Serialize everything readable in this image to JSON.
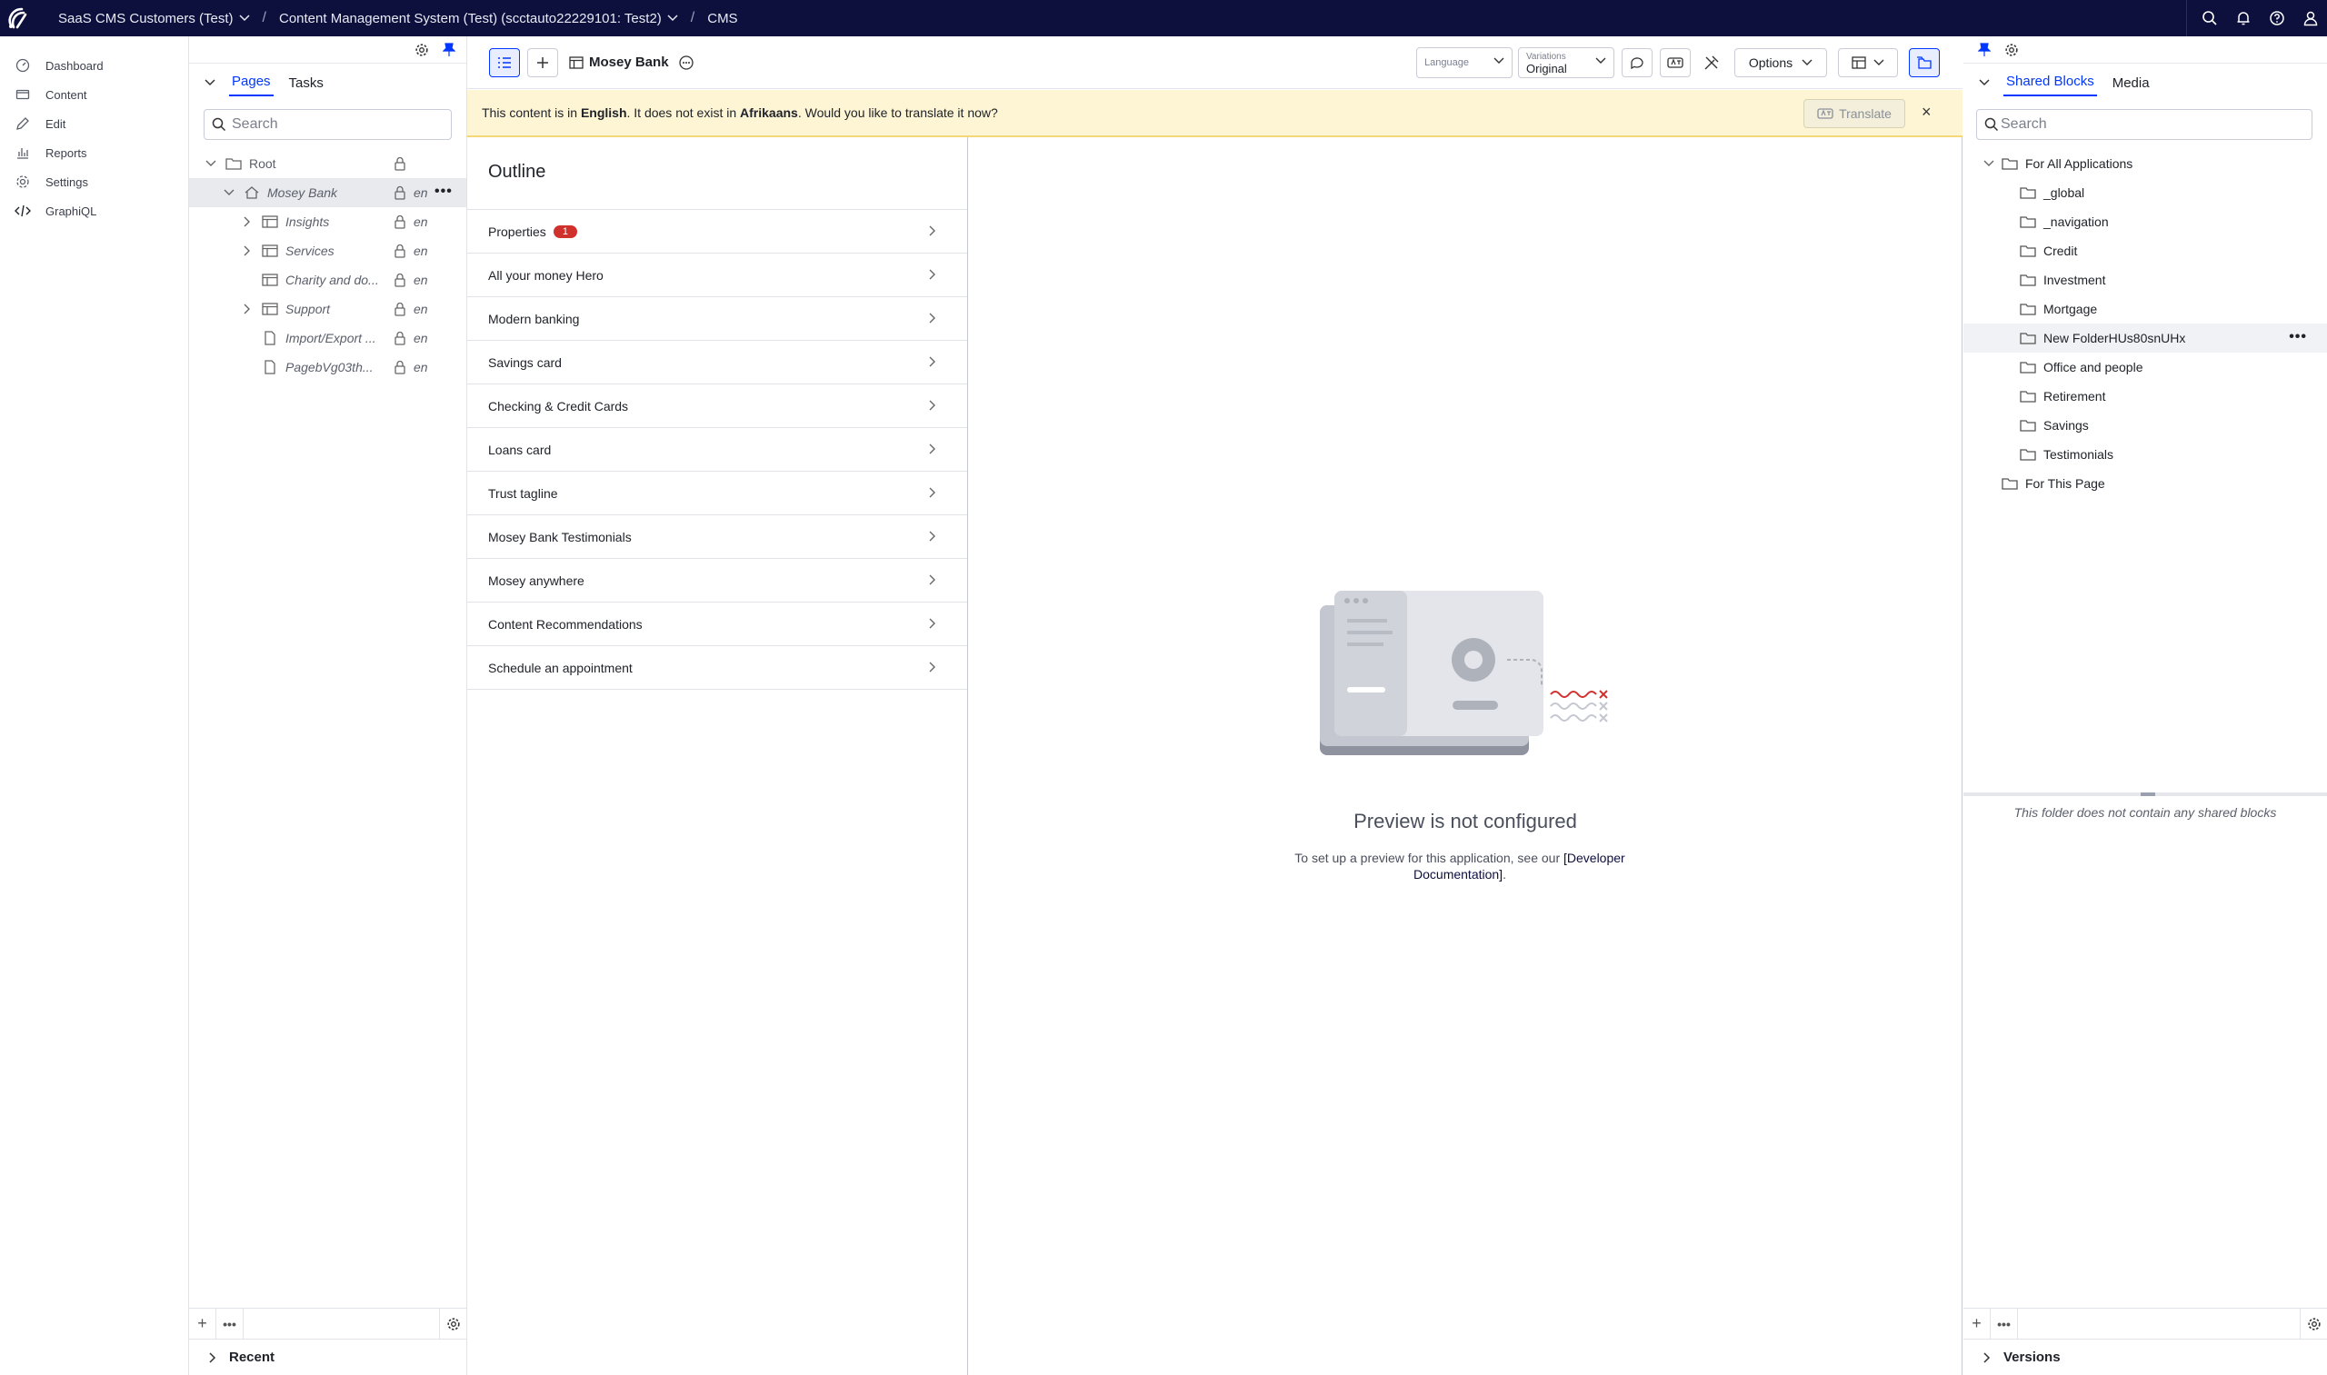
{
  "topbar": {
    "breadcrumbs": [
      {
        "label": "SaaS CMS Customers (Test)",
        "has_dropdown": true
      },
      {
        "label": "Content Management System (Test) (scctauto22229101: Test2)",
        "has_dropdown": true
      },
      {
        "label": "CMS",
        "has_dropdown": false
      }
    ],
    "icons": [
      "search-icon",
      "bell-icon",
      "help-icon",
      "user-icon"
    ]
  },
  "leftnav": {
    "items": [
      {
        "label": "Dashboard",
        "icon": "dashboard-icon"
      },
      {
        "label": "Content",
        "icon": "content-icon"
      },
      {
        "label": "Edit",
        "icon": "edit-icon"
      },
      {
        "label": "Reports",
        "icon": "reports-icon"
      },
      {
        "label": "Settings",
        "icon": "settings-icon"
      },
      {
        "label": "GraphiQL",
        "icon": "code-icon"
      }
    ]
  },
  "pages_panel": {
    "tabs": [
      "Pages",
      "Tasks"
    ],
    "active_tab": "Pages",
    "search_placeholder": "Search",
    "tree": [
      {
        "label": "Root",
        "italic": false,
        "lang": ""
      },
      {
        "label": "Mosey Bank",
        "italic": true,
        "lang": "en",
        "selected": true
      },
      {
        "label": "Insights",
        "italic": true,
        "lang": "en"
      },
      {
        "label": "Services",
        "italic": true,
        "lang": "en"
      },
      {
        "label": "Charity and do...",
        "italic": true,
        "lang": "en"
      },
      {
        "label": "Support",
        "italic": true,
        "lang": "en"
      },
      {
        "label": "Import/Export ...",
        "italic": true,
        "lang": "en"
      },
      {
        "label": "PagebVg03th...",
        "italic": true,
        "lang": "en"
      }
    ],
    "recent_label": "Recent"
  },
  "toolbar": {
    "page_title": "Mosey Bank",
    "language": {
      "label": "Language",
      "value": ""
    },
    "variations": {
      "label": "Variations",
      "value": "Original"
    },
    "options_label": "Options"
  },
  "banner": {
    "text_1": "This content is in ",
    "lang_current": "English",
    "text_2": ". It does not exist in ",
    "lang_missing": "Afrikaans",
    "text_3": ". Would you like to translate it now?",
    "translate_label": "Translate",
    "close": "×"
  },
  "outline": {
    "title": "Outline",
    "items": [
      {
        "label": "Properties",
        "badge": "1"
      },
      {
        "label": "All your money Hero"
      },
      {
        "label": "Modern banking"
      },
      {
        "label": "Savings card"
      },
      {
        "label": "Checking & Credit Cards"
      },
      {
        "label": "Loans card"
      },
      {
        "label": "Trust tagline"
      },
      {
        "label": "Mosey Bank Testimonials"
      },
      {
        "label": "Mosey anywhere"
      },
      {
        "label": "Content Recommendations"
      },
      {
        "label": "Schedule an appointment"
      }
    ]
  },
  "preview": {
    "title": "Preview is not configured",
    "desc_1": "To set up a preview for this application, see our ",
    "link": "[Developer Documentation]",
    "desc_2": "."
  },
  "right_panel": {
    "tabs": [
      "Shared Blocks",
      "Media"
    ],
    "active_tab": "Shared Blocks",
    "search_placeholder": "Search",
    "tree_root": "For All Applications",
    "folders": [
      "_global",
      "_navigation",
      "Credit",
      "Investment",
      "Mortgage",
      "New FolderHUs80snUHx",
      "Office and people",
      "Retirement",
      "Savings",
      "Testimonials"
    ],
    "highlighted_folder": "New FolderHUs80snUHx",
    "tree_root_2": "For This Page",
    "empty_message": "This folder does not contain any shared blocks",
    "versions_label": "Versions"
  },
  "colors": {
    "topbar": "#0d0f3d",
    "accent": "#0037ff",
    "banner": "#fdf5d4",
    "badge": "#d0312d"
  }
}
